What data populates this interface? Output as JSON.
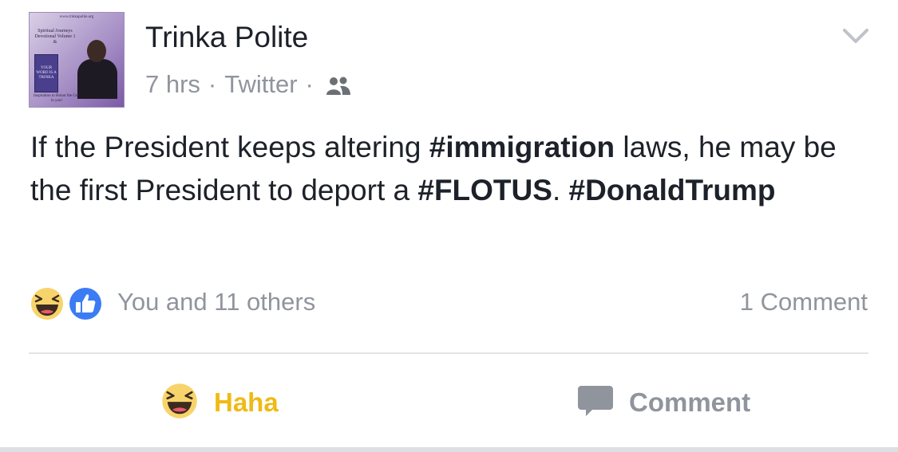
{
  "post": {
    "author": "Trinka Polite",
    "time": "7 hrs",
    "separator": "·",
    "source": "Twitter",
    "audience_icon": "friends-icon",
    "body": {
      "part1": "If the President keeps altering ",
      "hashtag1": "#immigration",
      "part2": " laws, he may be the first President to deport a ",
      "hashtag2": "#FLOTUS",
      "part3": ". ",
      "hashtag3": "#DonaldTrump"
    },
    "avatar": {
      "url_text": "www.trinkapolite.org",
      "title_text": "Spiritual Journeys Devotional Volume 1 &",
      "book_text": "YOUR WORD IS A TRINKA",
      "caption_text": "Inspiration to Honor the God in you!"
    }
  },
  "reactions": {
    "icons": [
      "haha-icon",
      "like-icon"
    ],
    "summary": "You and 11 others",
    "comments": "1 Comment"
  },
  "actions": {
    "haha_label": "Haha",
    "comment_label": "Comment"
  },
  "colors": {
    "text": "#1d2129",
    "meta": "#90949c",
    "haha": "#f0ba15",
    "like": "#3b7cf5"
  }
}
